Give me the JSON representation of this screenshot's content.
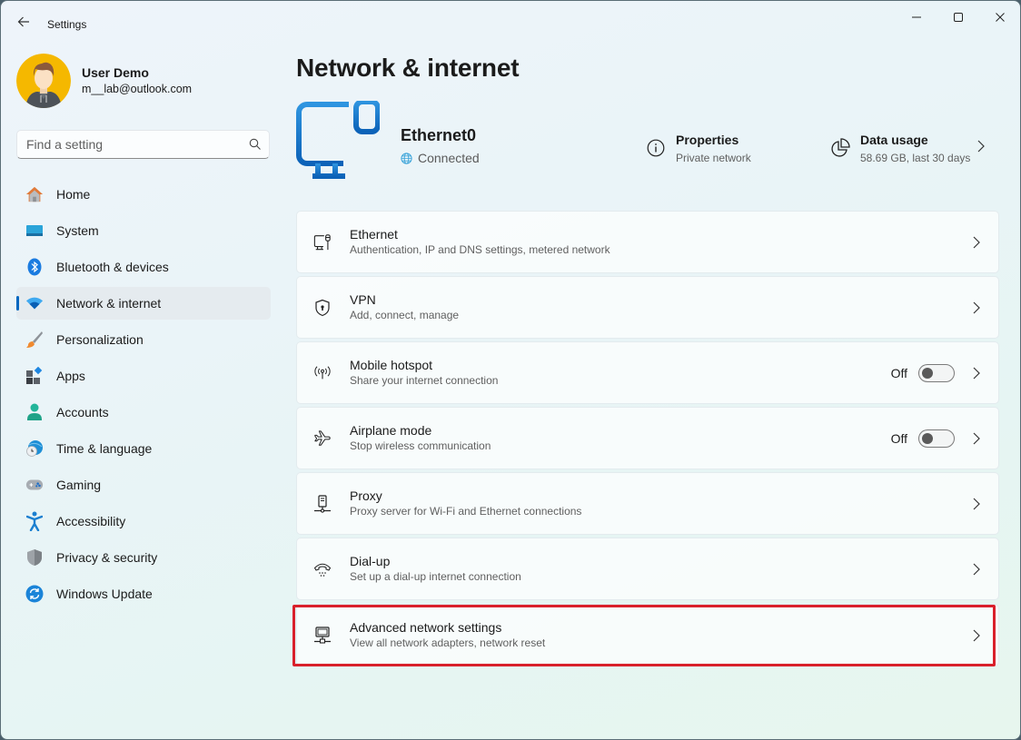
{
  "window": {
    "title": "Settings",
    "controls": {
      "minimize": "minimize",
      "maximize": "maximize",
      "close": "close"
    }
  },
  "profile": {
    "name": "User Demo",
    "email": "m__lab@outlook.com"
  },
  "search": {
    "placeholder": "Find a setting",
    "value": ""
  },
  "sidebar": {
    "active": "Network & internet",
    "items": [
      {
        "label": "Home",
        "icon": "home-icon"
      },
      {
        "label": "System",
        "icon": "system-icon"
      },
      {
        "label": "Bluetooth & devices",
        "icon": "bluetooth-icon"
      },
      {
        "label": "Network & internet",
        "icon": "wifi-icon"
      },
      {
        "label": "Personalization",
        "icon": "brush-icon"
      },
      {
        "label": "Apps",
        "icon": "apps-icon"
      },
      {
        "label": "Accounts",
        "icon": "accounts-icon"
      },
      {
        "label": "Time & language",
        "icon": "time-language-icon"
      },
      {
        "label": "Gaming",
        "icon": "gamepad-icon"
      },
      {
        "label": "Accessibility",
        "icon": "accessibility-icon"
      },
      {
        "label": "Privacy & security",
        "icon": "shield-icon"
      },
      {
        "label": "Windows Update",
        "icon": "update-icon"
      }
    ]
  },
  "main": {
    "title": "Network & internet",
    "hero": {
      "adapter_name": "Ethernet0",
      "status": "Connected",
      "properties": {
        "title": "Properties",
        "subtitle": "Private network"
      },
      "data_usage": {
        "title": "Data usage",
        "subtitle": "58.69 GB, last 30 days"
      }
    },
    "cards": [
      {
        "title": "Ethernet",
        "subtitle": "Authentication, IP and DNS settings, metered network",
        "icon": "ethernet-icon"
      },
      {
        "title": "VPN",
        "subtitle": "Add, connect, manage",
        "icon": "vpn-shield-icon"
      },
      {
        "title": "Mobile hotspot",
        "subtitle": "Share your internet connection",
        "icon": "hotspot-icon",
        "toggle": {
          "label": "Off",
          "on": false
        }
      },
      {
        "title": "Airplane mode",
        "subtitle": "Stop wireless communication",
        "icon": "airplane-icon",
        "toggle": {
          "label": "Off",
          "on": false
        }
      },
      {
        "title": "Proxy",
        "subtitle": "Proxy server for Wi-Fi and Ethernet connections",
        "icon": "proxy-icon"
      },
      {
        "title": "Dial-up",
        "subtitle": "Set up a dial-up internet connection",
        "icon": "dialup-icon"
      },
      {
        "title": "Advanced network settings",
        "subtitle": "View all network adapters, network reset",
        "icon": "advanced-network-icon",
        "highlighted": true
      }
    ],
    "highlight_color": "#d9202b",
    "accent_color": "#0067c0"
  }
}
